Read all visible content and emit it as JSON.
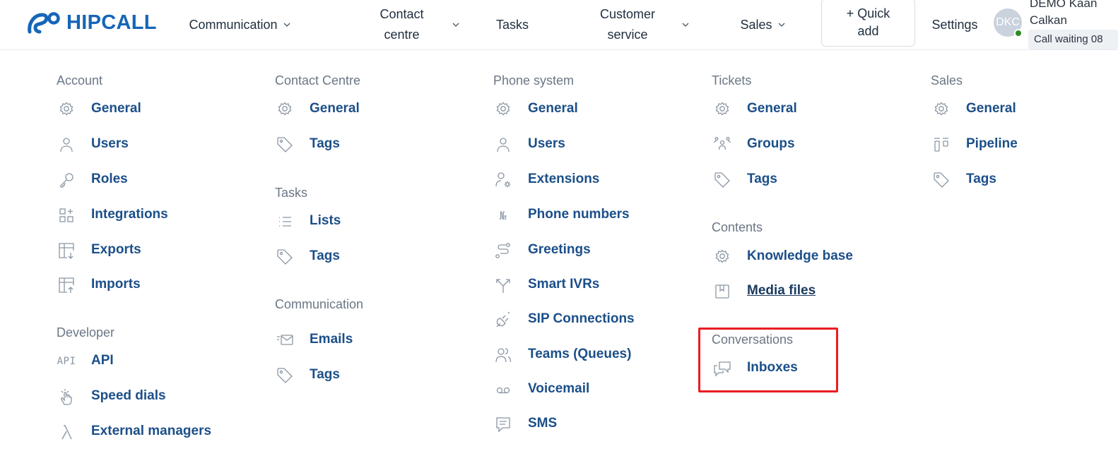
{
  "header": {
    "logo_text": "HIPCALL",
    "brand_color": "#1566b8",
    "nav": [
      {
        "label": "Communication",
        "has_dropdown": true
      },
      {
        "label_line1": "Contact",
        "label_line2": "centre",
        "has_dropdown": true
      },
      {
        "label": "Tasks",
        "has_dropdown": false
      },
      {
        "label_line1": "Customer",
        "label_line2": "service",
        "has_dropdown": true
      },
      {
        "label": "Sales",
        "has_dropdown": true
      }
    ],
    "quick_add": {
      "line1": "+ Quick",
      "line2": "add"
    },
    "settings_label": "Settings",
    "avatar_initials": "DKC",
    "user_name_line1": "DEMO Kaan",
    "user_name_line2": "Calkan",
    "call_status": "Call waiting 08",
    "status_color": "#2e8b22"
  },
  "menu": {
    "account": {
      "title": "Account",
      "items": [
        {
          "label": "General",
          "icon": "gear-icon"
        },
        {
          "label": "Users",
          "icon": "user-icon"
        },
        {
          "label": "Roles",
          "icon": "key-icon"
        },
        {
          "label": "Integrations",
          "icon": "grid-plus-icon"
        },
        {
          "label": "Exports",
          "icon": "table-export-icon"
        },
        {
          "label": "Imports",
          "icon": "table-import-icon"
        }
      ]
    },
    "developer": {
      "title": "Developer",
      "items": [
        {
          "label": "API",
          "icon_text": "API"
        },
        {
          "label": "Speed dials",
          "icon": "hand-tap-icon"
        },
        {
          "label": "External managers",
          "icon": "lambda-icon"
        }
      ]
    },
    "contact_centre": {
      "title": "Contact Centre",
      "items": [
        {
          "label": "General",
          "icon": "gear-icon"
        },
        {
          "label": "Tags",
          "icon": "tag-icon"
        }
      ]
    },
    "tasks": {
      "title": "Tasks",
      "items": [
        {
          "label": "Lists",
          "icon": "list-icon"
        },
        {
          "label": "Tags",
          "icon": "tag-icon"
        }
      ]
    },
    "communication": {
      "title": "Communication",
      "items": [
        {
          "label": "Emails",
          "icon": "mail-icon"
        },
        {
          "label": "Tags",
          "icon": "tag-icon"
        }
      ]
    },
    "phone_system": {
      "title": "Phone system",
      "items": [
        {
          "label": "General",
          "icon": "gear-icon"
        },
        {
          "label": "Users",
          "icon": "user-icon"
        },
        {
          "label": "Extensions",
          "icon": "user-settings-icon"
        },
        {
          "label": "Phone numbers",
          "icon_text": "№"
        },
        {
          "label": "Greetings",
          "icon": "route-icon"
        },
        {
          "label": "Smart IVRs",
          "icon": "split-arrow-icon"
        },
        {
          "label": "SIP Connections",
          "icon": "plug-icon"
        },
        {
          "label": "Teams (Queues)",
          "icon": "users-icon"
        },
        {
          "label": "Voicemail",
          "icon": "voicemail-icon"
        },
        {
          "label": "SMS",
          "icon": "message-icon"
        }
      ]
    },
    "tickets": {
      "title": "Tickets",
      "items": [
        {
          "label": "General",
          "icon": "gear-icon"
        },
        {
          "label": "Groups",
          "icon": "group-icon"
        },
        {
          "label": "Tags",
          "icon": "tag-icon"
        }
      ]
    },
    "contents": {
      "title": "Contents",
      "items": [
        {
          "label": "Knowledge base",
          "icon": "gear-icon"
        },
        {
          "label": "Media files",
          "icon": "book-icon"
        }
      ]
    },
    "conversations": {
      "title": "Conversations",
      "items": [
        {
          "label": "Inboxes",
          "icon": "chat-icon"
        }
      ]
    },
    "sales": {
      "title": "Sales",
      "items": [
        {
          "label": "General",
          "icon": "gear-icon"
        },
        {
          "label": "Pipeline",
          "icon": "pipeline-icon"
        },
        {
          "label": "Tags",
          "icon": "tag-icon"
        }
      ]
    }
  },
  "highlight_color": "#ea1c24"
}
